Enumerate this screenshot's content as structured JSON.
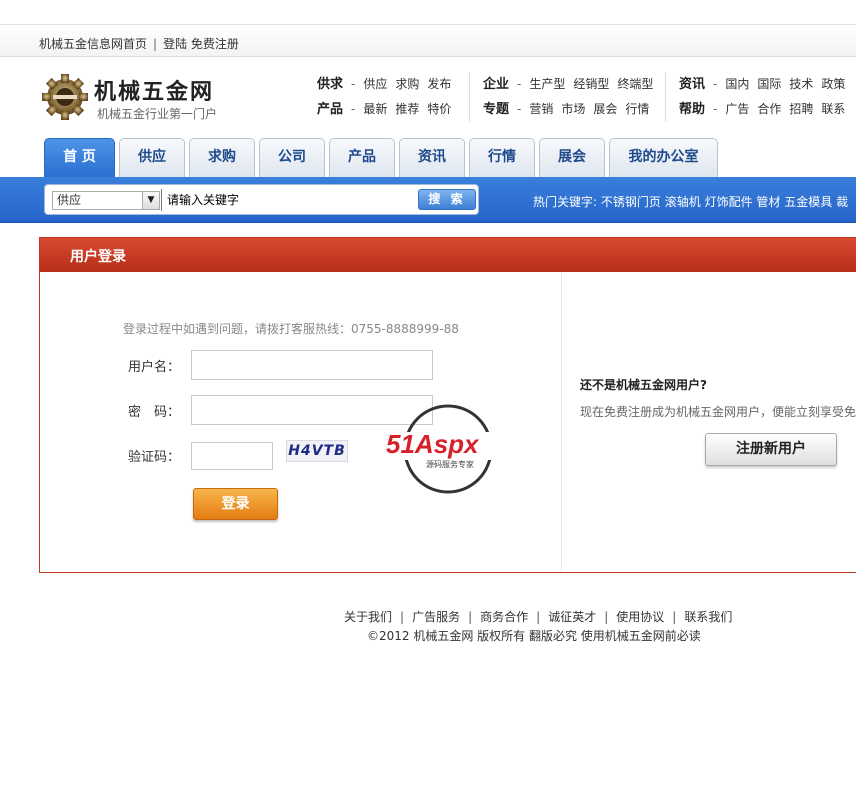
{
  "topbar": {
    "home_link": "机械五金信息网首页",
    "login_link": "登陆",
    "register_link": "免费注册"
  },
  "logo": {
    "title": "机械五金网",
    "subtitle": "机械五金行业第一门户"
  },
  "quick_nav": [
    {
      "rows": [
        {
          "title": "供求",
          "links": [
            "供应",
            "求购",
            "发布"
          ]
        },
        {
          "title": "产品",
          "links": [
            "最新",
            "推荐",
            "特价"
          ]
        }
      ]
    },
    {
      "rows": [
        {
          "title": "企业",
          "links": [
            "生产型",
            "经销型",
            "终端型"
          ]
        },
        {
          "title": "专题",
          "links": [
            "营销",
            "市场",
            "展会",
            "行情"
          ]
        }
      ]
    },
    {
      "rows": [
        {
          "title": "资讯",
          "links": [
            "国内",
            "国际",
            "技术",
            "政策"
          ]
        },
        {
          "title": "帮助",
          "links": [
            "广告",
            "合作",
            "招聘",
            "联系"
          ]
        }
      ]
    }
  ],
  "tabs": [
    {
      "label": "首 页",
      "active": true
    },
    {
      "label": "供应"
    },
    {
      "label": "求购"
    },
    {
      "label": "公司"
    },
    {
      "label": "产品"
    },
    {
      "label": "资讯"
    },
    {
      "label": "行情"
    },
    {
      "label": "展会"
    },
    {
      "label": "我的办公室"
    }
  ],
  "search": {
    "category_selected": "供应",
    "keyword_placeholder": "请输入关键字",
    "button_label": "搜 索",
    "hot_keywords_label": "热门关键字:",
    "hot_keywords": [
      "不锈钢门页",
      "滚轴机",
      "灯饰配件",
      "管材",
      "五金模具",
      "裁"
    ]
  },
  "login": {
    "panel_title": "用户登录",
    "hint": "登录过程中如遇到问题，请拨打客服热线：0755-8888999-88",
    "username_label": "用户名：",
    "password_label": "密　码：",
    "captcha_label": "验证码：",
    "captcha_text": "H4VTB",
    "submit_label": "登录",
    "watermark_text": "51Aspx",
    "watermark_sub": "源码服务专家"
  },
  "register": {
    "question": "还不是机械五金网用户?",
    "description": "现在免费注册成为机械五金网用户，便能立刻享受免费",
    "button_label": "注册新用户"
  },
  "footer": {
    "links": [
      "关于我们",
      "广告服务",
      "商务合作",
      "诚征英才",
      "使用协议",
      "联系我们"
    ],
    "copyright": "©2012 机械五金网 版权所有 翻版必究 使用机械五金网前必读"
  },
  "colors": {
    "accent_blue": "#2a6fd2",
    "panel_red": "#c43a25",
    "login_orange": "#e47b12"
  }
}
